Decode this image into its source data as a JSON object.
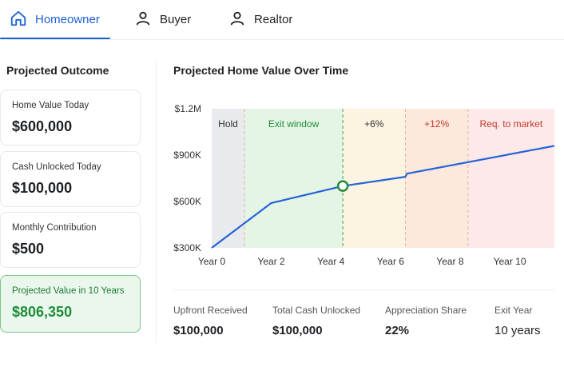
{
  "tabs": [
    {
      "label": "Homeowner",
      "icon": "home-icon",
      "active": true
    },
    {
      "label": "Buyer",
      "icon": "user-icon",
      "active": false
    },
    {
      "label": "Realtor",
      "icon": "user-icon",
      "active": false
    }
  ],
  "left": {
    "title": "Projected Outcome",
    "cards": [
      {
        "label": "Home Value Today",
        "value": "$600,000"
      },
      {
        "label": "Cash Unlocked Today",
        "value": "$100,000"
      },
      {
        "label": "Monthly Contribution",
        "value": "$500"
      },
      {
        "label": "Projected Value in 10 Years",
        "value": "$806,350"
      }
    ]
  },
  "chart": {
    "title": "Projected Home Value Over Time"
  },
  "chart_data": {
    "type": "line",
    "xlim": [
      0,
      11.5
    ],
    "ylim": [
      300000,
      1200000
    ],
    "yticks": [
      {
        "value": 300000,
        "label": "$300K"
      },
      {
        "value": 600000,
        "label": "$600K"
      },
      {
        "value": 900000,
        "label": "$900K"
      },
      {
        "value": 1200000,
        "label": "$1.2M"
      }
    ],
    "xticks": [
      {
        "value": 0,
        "label": "Year 0"
      },
      {
        "value": 2,
        "label": "Year 2"
      },
      {
        "value": 4,
        "label": "Year 4"
      },
      {
        "value": 6,
        "label": "Year 6"
      },
      {
        "value": 8,
        "label": "Year 8"
      },
      {
        "value": 10,
        "label": "Year 10"
      }
    ],
    "zones": [
      {
        "label": "Hold",
        "x0": 0,
        "x1": 1.1,
        "fill": "#e9eaed",
        "text": "#333333"
      },
      {
        "label": "Exit window",
        "x0": 1.1,
        "x1": 4.4,
        "fill": "#e4f5e5",
        "text": "#1f8c3a"
      },
      {
        "label": "+6%",
        "x0": 4.4,
        "x1": 6.5,
        "fill": "#fdf3e1",
        "text": "#333333"
      },
      {
        "label": "+12%",
        "x0": 6.5,
        "x1": 8.6,
        "fill": "#fde8dc",
        "text": "#c0392b"
      },
      {
        "label": "Req. to market",
        "x0": 8.6,
        "x1": 11.5,
        "fill": "#fde9e9",
        "text": "#c0392b"
      }
    ],
    "series": [
      {
        "color": "#2563d9",
        "points": [
          [
            0,
            300000
          ],
          [
            2,
            590000
          ],
          [
            4.4,
            700000
          ],
          [
            6.5,
            760000
          ],
          [
            6.55,
            780000
          ],
          [
            11.5,
            960000
          ]
        ]
      }
    ],
    "marker": {
      "x": 4.4,
      "y": 700000,
      "color": "#1f8c3a"
    }
  },
  "summary": [
    {
      "label": "Upfront Received",
      "value": "$100,000",
      "bold": true
    },
    {
      "label": "Total Cash Unlocked",
      "value": "$100,000",
      "bold": true
    },
    {
      "label": "Appreciation Share",
      "value": "22%",
      "bold": true
    },
    {
      "label": "Exit Year",
      "value": "10 years",
      "bold": false
    }
  ]
}
